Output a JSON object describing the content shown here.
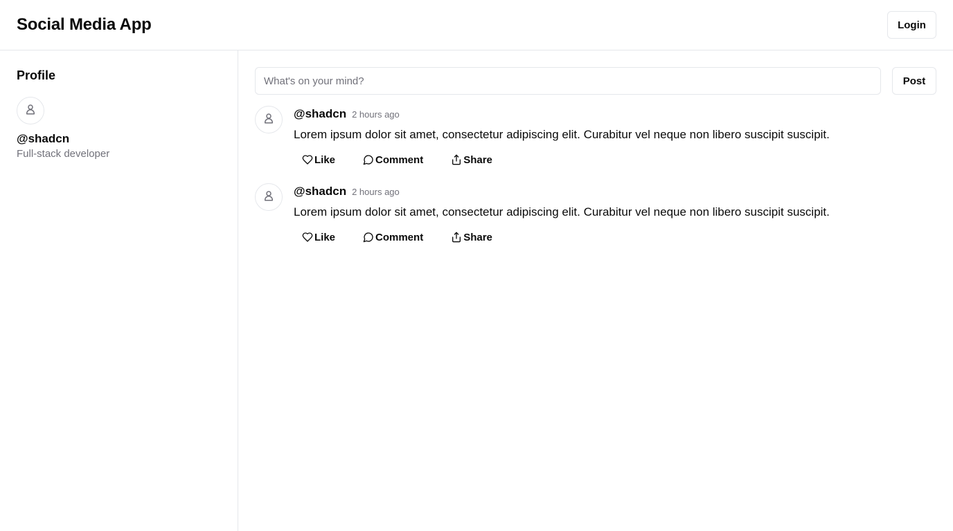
{
  "header": {
    "title": "Social Media App",
    "login_label": "Login"
  },
  "sidebar": {
    "heading": "Profile",
    "avatar_icon": "user-icon",
    "handle": "@shadcn",
    "bio": "Full-stack developer"
  },
  "composer": {
    "placeholder": "What's on your mind?",
    "post_label": "Post"
  },
  "posts": [
    {
      "handle": "@shadcn",
      "time": "2 hours ago",
      "text": "Lorem ipsum dolor sit amet, consectetur adipiscing elit. Curabitur vel neque non libero suscipit suscipit.",
      "actions": {
        "like": "Like",
        "comment": "Comment",
        "share": "Share"
      }
    },
    {
      "handle": "@shadcn",
      "time": "2 hours ago",
      "text": "Lorem ipsum dolor sit amet, consectetur adipiscing elit. Curabitur vel neque non libero suscipit suscipit.",
      "actions": {
        "like": "Like",
        "comment": "Comment",
        "share": "Share"
      }
    }
  ],
  "icons": {
    "avatar": "user-icon",
    "like": "heart-icon",
    "comment": "message-circle-icon",
    "share": "share-icon"
  },
  "colors": {
    "border": "#e5e7eb",
    "muted_text": "#71717a",
    "text": "#0a0a0a"
  }
}
